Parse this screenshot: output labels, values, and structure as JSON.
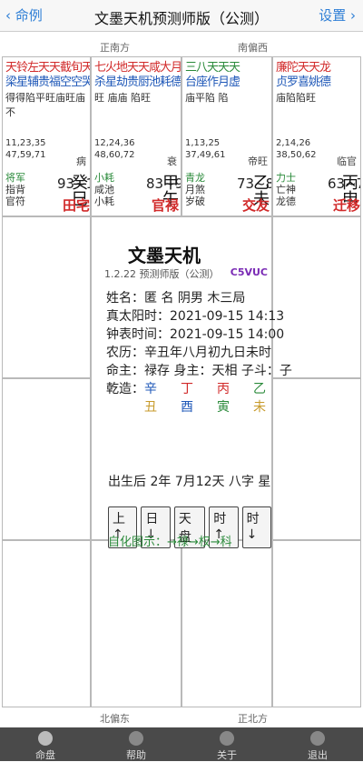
{
  "nav": {
    "back_label": "命例",
    "title": "文墨天机预测师版（公测）",
    "settings_label": "设置"
  },
  "directions": {
    "top_left": "正南方",
    "top_right": "南偏西",
    "bottom_left": "北偏东",
    "bottom_right": "正北方"
  },
  "palaces": [
    {
      "stars": "天铃左天天截旬天",
      "stars2": "梁星辅贵福空空哭",
      "row2": "得得陷平旺庙旺庙不",
      "ages": [
        "11,23,35",
        "47,59,71"
      ],
      "ring": "病",
      "god": [
        "将军",
        "指背",
        "官符"
      ],
      "range": "93~104",
      "gz": "癸巳",
      "palace": "田宅"
    },
    {
      "stars": "七火地天天咸大月",
      "stars2": "杀星劫贵厨池耗德",
      "row2": "旺 庙庙    陷旺",
      "ages": [
        "12,24,36",
        "48,60,72"
      ],
      "ring": "衰",
      "god": [
        "小耗",
        "咸池",
        "小耗"
      ],
      "range": "83~92",
      "gz": "甲午",
      "palace": "官禄"
    },
    {
      "stars": "三八天天天",
      "stars2": "台座作月虚",
      "row2": "庙平陷  陷",
      "ages": [
        "1,13,25",
        "37,49,61"
      ],
      "ring": "帝旺",
      "god": [
        "青龙",
        "月煞",
        "岁破"
      ],
      "range": "73~82",
      "gz": "乙未",
      "palace": "交友"
    },
    {
      "stars": "廉陀天天龙",
      "stars2": "贞罗喜姚德",
      "row2": "庙陷陷旺",
      "ages": [
        "2,14,26",
        "38,50,62"
      ],
      "ring": "临官",
      "god": [
        "力士",
        "亡神",
        "龙德"
      ],
      "range": "63~72",
      "gz": "丙申",
      "palace": "迁移"
    }
  ],
  "center": {
    "title": "文墨天机",
    "version": "1.2.22 预测师版（公测）",
    "code": "C5VUC",
    "lines": [
      "姓名：匿 名      阴男 木三局",
      "真太阳时：2021-09-15 14:13",
      "钟表时间：2021-09-15 14:00",
      "农历：辛丑年八月初九日未时",
      "命主：禄存 身主：天相 子斗：子",
      "乾造："
    ],
    "stems": [
      "辛",
      "丁",
      "丙",
      "乙"
    ],
    "branches": [
      "丑",
      "酉",
      "寅",
      "未"
    ],
    "big": "出生后 2年 7月12天 八字 星",
    "buttons": [
      "上↑",
      "日↓",
      "天盘",
      "时↑",
      "时↓"
    ],
    "baihua": "自化图示：→禄→权→科"
  },
  "tabs": [
    "命盘",
    "帮助",
    "关于",
    "退出"
  ]
}
